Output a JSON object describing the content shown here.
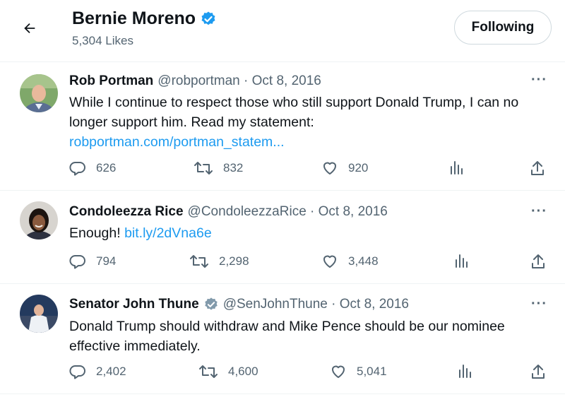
{
  "header": {
    "name": "Bernie Moreno",
    "likes": "5,304 Likes",
    "follow_label": "Following"
  },
  "colors": {
    "verified": "#1d9bf0",
    "verified_gray": "#829aab",
    "link": "#1d9bf0"
  },
  "tweets": [
    {
      "name": "Rob Portman",
      "meta": "@robportman · Oct 8, 2016",
      "text": "While I continue to respect those who still support Donald Trump, I can no longer support him. Read my statement:",
      "link": "robportman.com/portman_statem...",
      "replies": "626",
      "retweets": "832",
      "likes": "920"
    },
    {
      "name": "Condoleezza Rice",
      "meta": "@CondoleezzaRice · Oct 8, 2016",
      "text": "Enough! ",
      "link": "bit.ly/2dVna6e",
      "replies": "794",
      "retweets": "2,298",
      "likes": "3,448"
    },
    {
      "name": "Senator John Thune",
      "meta": "@SenJohnThune · Oct 8, 2016",
      "text": "Donald Trump should withdraw and Mike Pence should be our nominee effective immediately.",
      "replies": "2,402",
      "retweets": "4,600",
      "likes": "5,041"
    }
  ],
  "icons": [
    "back-arrow-icon",
    "verified-badge-icon",
    "more-icon",
    "reply-icon",
    "retweet-icon",
    "like-icon",
    "views-icon",
    "share-icon"
  ]
}
